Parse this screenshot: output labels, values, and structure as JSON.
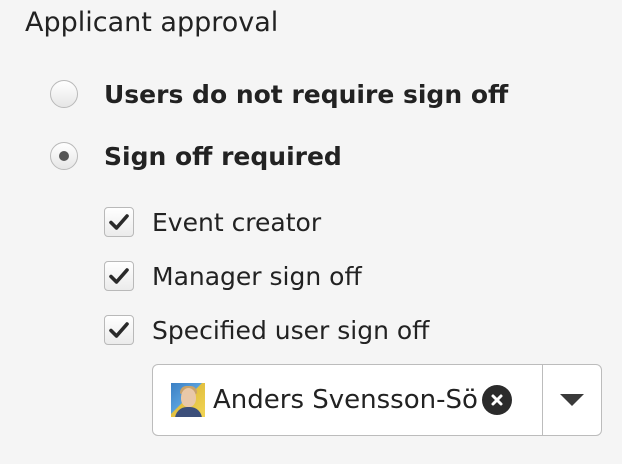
{
  "section": {
    "title": "Applicant approval"
  },
  "approval_options": [
    {
      "label": "Users do not require sign off",
      "selected": false
    },
    {
      "label": "Sign off required",
      "selected": true
    }
  ],
  "sign_off_checks": [
    {
      "label": "Event creator",
      "checked": true
    },
    {
      "label": "Manager sign off",
      "checked": true
    },
    {
      "label": "Specified user sign off",
      "checked": true
    }
  ],
  "user_select": {
    "selected_user": "Anders Svensson-Sö",
    "avatar_icon": "user-avatar",
    "clear_icon": "clear-circle-icon",
    "dropdown_icon": "caret-down-icon"
  },
  "colors": {
    "background": "#f5f5f5",
    "text": "#222222",
    "border": "#bcbcbc",
    "control_fill": "#ffffff"
  }
}
